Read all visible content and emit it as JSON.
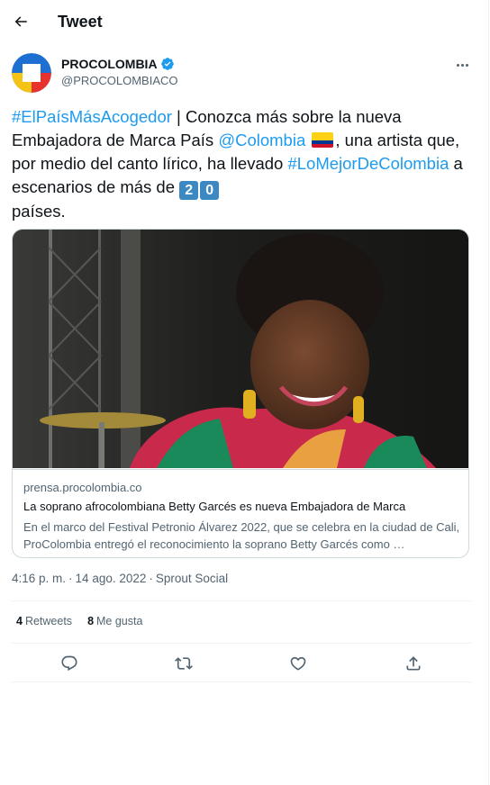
{
  "header": {
    "title": "Tweet",
    "back_icon": "arrow-left-icon"
  },
  "author": {
    "name": "PROCOLOMBIA",
    "handle": "@PROCOLOMBIACO",
    "verified_icon": "verified-badge-icon",
    "avatar_colors": [
      "#1d6fd1",
      "#e8322e",
      "#f5c314"
    ]
  },
  "tweet": {
    "parts": {
      "hashtag1": "#ElPaísMásAcogedor",
      "text1": " | Conozca más sobre la nueva Embajadora de Marca País ",
      "mention": "@Colombia",
      "text2": ", una artista que, por medio del canto lírico, ha llevado ",
      "hashtag2": "#LoMejorDeColombia",
      "text3": " a escenarios de más de ",
      "num1": "2",
      "num2": "0",
      "text4": " países."
    },
    "flag_icon": "colombia-flag-icon",
    "link_color": "#1d9bf0"
  },
  "card": {
    "domain": "prensa.procolombia.co",
    "title": "La soprano afrocolombiana Betty Garcés es nueva Embajadora de Marca",
    "description": "En el marco del Festival Petronio Álvarez 2022, que se celebra en la ciudad de Cali, ProColombia entregó el reconocimiento la soprano Betty Garcés como …"
  },
  "meta": {
    "time": "4:16 p. m.",
    "date": "14 ago. 2022",
    "source": "Sprout Social",
    "separator": "·"
  },
  "stats": {
    "retweets_count": "4",
    "retweets_label": "Retweets",
    "likes_count": "8",
    "likes_label": "Me gusta"
  },
  "actions": [
    "reply-icon",
    "retweet-icon",
    "like-icon",
    "share-icon"
  ]
}
